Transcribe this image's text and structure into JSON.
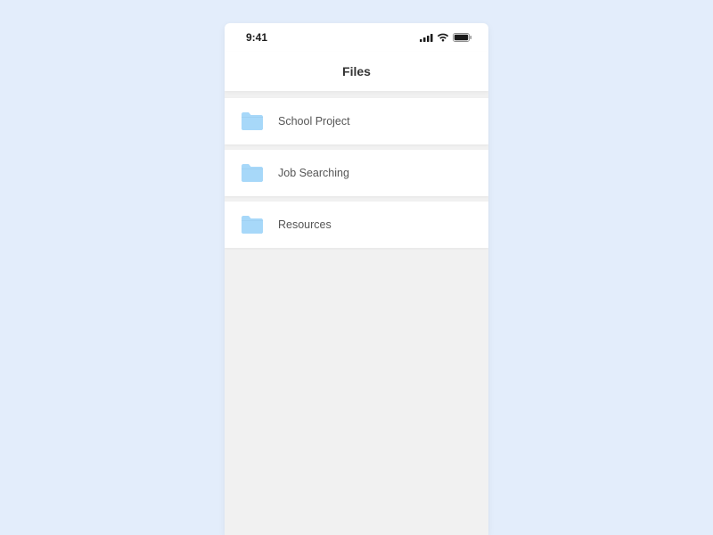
{
  "status_bar": {
    "time": "9:41"
  },
  "header": {
    "title": "Files"
  },
  "folders": [
    {
      "label": "School Project"
    },
    {
      "label": "Job Searching"
    },
    {
      "label": "Resources"
    }
  ]
}
